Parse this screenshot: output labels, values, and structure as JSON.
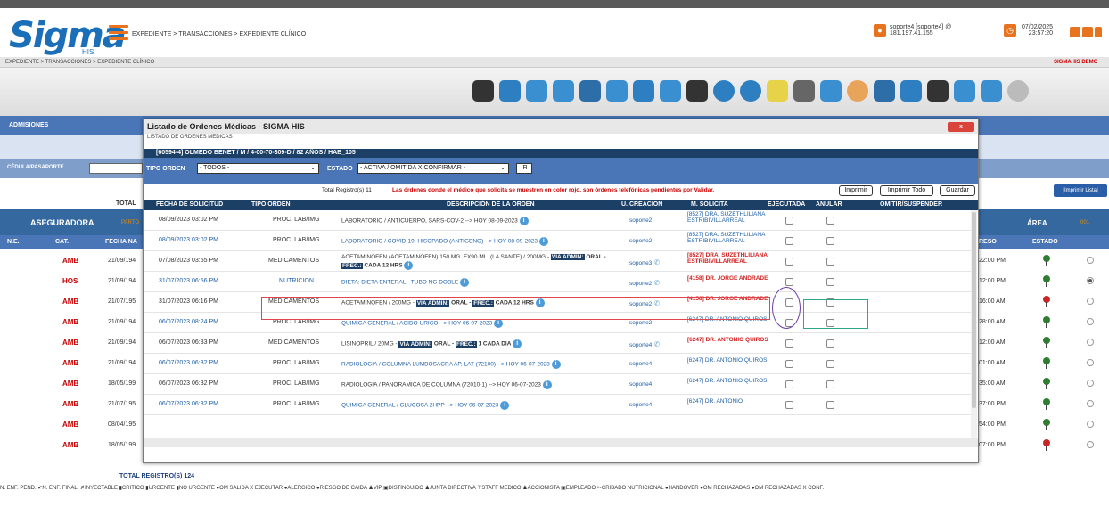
{
  "app": {
    "logo": "Sigma",
    "logo_sub": "HIS",
    "breadcrumb": "EXPEDIENTE > TRANSACCIONES > EXPEDIENTE CLÍNICO",
    "breadcrumb2": "EXPEDIENTE > TRANSACCIONES > EXPEDIENTE CLÍNICO",
    "brand": "SIGMAHIS DEMO",
    "user": "soporte4 [soporte4] @",
    "ip": "181.197.41.155",
    "date": "07/02/2025",
    "time": "23:57:20"
  },
  "background": {
    "admisiones": "ADMISIONES",
    "cedula_label": "CÉDULA/PASAPORTE",
    "total_label": "TOTAL",
    "imprimir_lista": "[Imprimir Lista]",
    "aseguradora": "ASEGURADORA",
    "parto": "PARTO",
    "area": "ÁREA",
    "area_val": "001",
    "col_ne": "N.E.",
    "col_cat": "CAT.",
    "col_fecha": "FECHA NA",
    "col_ingreso": "RESO",
    "col_estado": "ESTADO",
    "left_rows": [
      {
        "cat": "AMB",
        "date": "21/09/194"
      },
      {
        "cat": "HOS",
        "date": "21/09/194"
      },
      {
        "cat": "AMB",
        "date": "21/07/195"
      },
      {
        "cat": "AMB",
        "date": "21/09/194"
      },
      {
        "cat": "AMB",
        "date": "21/09/194"
      },
      {
        "cat": "AMB",
        "date": "21/09/194"
      },
      {
        "cat": "AMB",
        "date": "18/05/199"
      },
      {
        "cat": "AMB",
        "date": "21/07/195"
      },
      {
        "cat": "AMB",
        "date": "08/04/195"
      },
      {
        "cat": "AMB",
        "date": "18/05/199"
      }
    ],
    "right_rows": [
      {
        "time": "22:00 PM",
        "pin": "#2e7d32",
        "radio": false
      },
      {
        "time": "12:00 PM",
        "pin": "#2e7d32",
        "radio": true
      },
      {
        "time": "16:00 AM",
        "pin": "#c62828",
        "radio": false
      },
      {
        "time": "28:00 AM",
        "pin": "#2e7d32",
        "radio": false
      },
      {
        "time": "12:00 AM",
        "pin": "#2e7d32",
        "radio": false
      },
      {
        "time": "01:00 AM",
        "pin": "#2e7d32",
        "radio": false
      },
      {
        "time": "35:00 AM",
        "pin": "#2e7d32",
        "radio": false
      },
      {
        "time": "37:00 PM",
        "pin": "#2e7d32",
        "radio": false
      },
      {
        "time": "54:00 PM",
        "pin": "#2e7d32",
        "radio": false
      },
      {
        "time": "07:00 PM",
        "pin": "#c62828",
        "radio": false
      }
    ],
    "total_registros": "TOTAL REGISTRO(S) 124",
    "legend": "N. ENF. PEND. ✔N. ENF. FINAL. ✗INYECTABLE ▮CRITICO ▮URGENTE ▮NO URGENTE ●OM SALIDA X EJECUTAR ●ALERGICO ●RIESGO DE CAIDA ♟VIP ▣DISTINGUIDO ♟JUNTA DIRECTIVA ⊤STAFF MEDICO ♟ACCIONISTA ▣EMPLEADO ✂CRIBADO NUTRICIONAL ●HANDOVER ●OM RECHAZADAS ●OM RECHAZADAS X CONF."
  },
  "modal": {
    "title": "Listado de Ordenes Médicas - SIGMA HIS",
    "close": "x",
    "subtitle": "LISTADO DE ORDENES MEDICAS",
    "patient": "[60594-4]  OLMEDO BENET  / M  / 4-00-70-309-D  / 82 AÑOS /  HAB_105",
    "tipo_label": "TIPO ORDEN",
    "tipo_value": "- TODOS -",
    "estado_label": "ESTADO",
    "estado_value": "- ACTIVA / OMITIDA X CONFIRMAR -",
    "ir": "IR",
    "total": "Total Registro(s) 11",
    "warning": "Las órdenes donde el médico que solicita se muestren en color rojo, son órdenes telefónicas pendientes por Validar.",
    "btn_imprimir": "Imprimir",
    "btn_imprimir_todo": "Imprimir Todo",
    "btn_guardar": "Guardar",
    "headers": {
      "fecha": "FECHA DE SOLICITUD",
      "tipo": "TIPO ORDEN",
      "desc": "DESCRIPCIÓN DE LA ORDEN",
      "ucre": "U. CREACION",
      "msol": "M. SOLICITA",
      "ejec": "EJECUTADA",
      "anul": "ANULAR",
      "omit": "OMITIR/SUSPENDER"
    },
    "rows": [
      {
        "fecha": "08/09/2023 03:02 PM",
        "fecha_blue": false,
        "tipo": "PROC. LAB/IMG",
        "tipo_blue": false,
        "desc": "LABORATORIO / ANTICUERPO, SARS-COV-2 --> HOY 08-09-2023",
        "desc_blue": false,
        "user": "soporte2",
        "phone": false,
        "med": "[8527] DRA. SUZETHLILIANA ESTRIBIVILLARREAL",
        "med_red": false
      },
      {
        "fecha": "08/09/2023 03:02 PM",
        "fecha_blue": true,
        "tipo": "PROC. LAB/IMG",
        "tipo_blue": false,
        "desc": "LABORATORIO / COVID-19; HISOPADO (ANTIGENO) --> HOY 08-09-2023",
        "desc_blue": true,
        "user": "soporte2",
        "phone": false,
        "med": "[8527] DRA. SUZETHLILIANA ESTRIBIVILLARREAL",
        "med_red": false
      },
      {
        "fecha": "07/08/2023 03:55 PM",
        "fecha_blue": false,
        "tipo": "MEDICAMENTOS",
        "tipo_blue": false,
        "desc": "ACETAMINOFEN (ACETAMINOFEN) 150 MG. FX90 ML. (LA SANTE) / 200MG -",
        "desc2_tag1": "VIA ADMIN:",
        "desc2_mid": "ORAL -",
        "desc2_tag2": "FREC.:",
        "desc2_end": "CADA 12 HRS",
        "desc_blue": false,
        "user": "soporte3",
        "phone": true,
        "med": "[8527] DRA. SUZETHLILIANA ESTRIBIVILLARREAL",
        "med_red": true
      },
      {
        "fecha": "31/07/2023 06:56 PM",
        "fecha_blue": true,
        "tipo": "NUTRICION",
        "tipo_blue": true,
        "desc": "DIETA: DIETA ENTERAL - TUBO NG DOBLE",
        "desc_blue": true,
        "user": "soporte2",
        "phone": true,
        "med": "[4158] DR. JORGE ANDRADE",
        "med_red": true
      },
      {
        "fecha": "31/07/2023 06:16 PM",
        "fecha_blue": false,
        "tipo": "MEDICAMENTOS",
        "tipo_blue": false,
        "desc": "ACETAMINOFEN / 200MG -",
        "desc2_tag1": "VIA ADMIN:",
        "desc2_mid": "ORAL -",
        "desc2_tag2": "FREC.:",
        "desc2_end": "CADA 12 HRS",
        "desc_blue": false,
        "user": "soporte2",
        "phone": true,
        "med": "[4158] DR. JORGE ANDRADE",
        "med_red": true
      },
      {
        "fecha": "06/07/2023 08:24 PM",
        "fecha_blue": true,
        "tipo": "PROC. LAB/IMG",
        "tipo_blue": false,
        "desc": "QUIMICA GENERAL / ACIDO URICO --> HOY 06-07-2023",
        "desc_blue": true,
        "user": "soporte2",
        "phone": false,
        "med": "[6247] DR. ANTONIO QUIROS",
        "med_red": false
      },
      {
        "fecha": "06/07/2023 06:33 PM",
        "fecha_blue": false,
        "tipo": "MEDICAMENTOS",
        "tipo_blue": false,
        "desc": "LISINOPRIL / 20MG -",
        "desc2_tag1": "VIA ADMIN:",
        "desc2_mid": "ORAL -",
        "desc2_tag2": "FREC.:",
        "desc2_end": "1 CADA DIA",
        "desc_blue": false,
        "user": "soporte4",
        "phone": true,
        "med": "[6247] DR. ANTONIO QUIROS",
        "med_red": true
      },
      {
        "fecha": "06/07/2023 06:32 PM",
        "fecha_blue": true,
        "tipo": "PROC. LAB/IMG",
        "tipo_blue": false,
        "desc": "RADIOLOGIA / COLUMNA LUMBOSACRA AP, LAT (72100) --> HOY 06-07-2023",
        "desc_blue": true,
        "user": "soporte4",
        "phone": false,
        "med": "[6247] DR. ANTONIO QUIROS",
        "med_red": false
      },
      {
        "fecha": "06/07/2023 06:32 PM",
        "fecha_blue": false,
        "tipo": "PROC. LAB/IMG",
        "tipo_blue": false,
        "desc": "RADIOLOGIA / PANORAMICA DE COLUMNA (72010-1) --> HOY 06-07-2023",
        "desc_blue": false,
        "user": "soporte4",
        "phone": false,
        "med": "[6247] DR. ANTONIO QUIROS",
        "med_red": false
      },
      {
        "fecha": "06/07/2023 06:32 PM",
        "fecha_blue": true,
        "tipo": "PROC. LAB/IMG",
        "tipo_blue": false,
        "desc": "QUIMICA GENERAL / GLUCOSA 2HPP --> HOY 06-07-2023",
        "desc_blue": true,
        "user": "soporte4",
        "phone": false,
        "med": "[6247] DR. ANTONIO",
        "med_red": false
      }
    ]
  }
}
